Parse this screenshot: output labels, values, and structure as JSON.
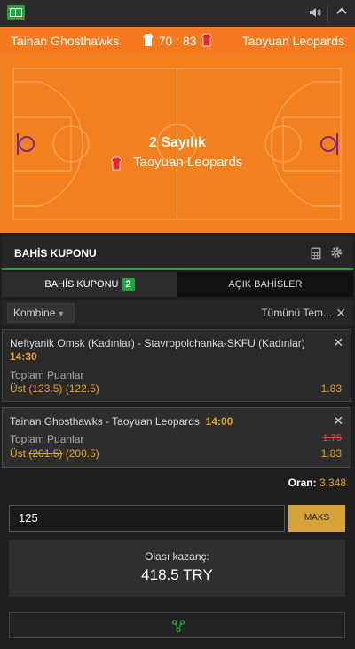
{
  "scoreboard": {
    "home_team": "Tainan Ghosthawks",
    "away_team": "Taoyuan Leopards",
    "score": "70 : 83"
  },
  "event": {
    "title": "2 Sayılık",
    "team": "Taoyuan Leopards"
  },
  "betslip": {
    "header": "BAHİS KUPONU",
    "tabs": [
      {
        "label": "BAHİS KUPONU",
        "badge": "2"
      },
      {
        "label": "AÇIK BAHİSLER"
      }
    ],
    "mode": "Kombine",
    "clear_all": "Tümünü Tem...",
    "bets": [
      {
        "match": "Neftyanik Omsk (Kadınlar) - Stavropolchanka-SKFU (Kadınlar)",
        "time": "14:30",
        "market": "Toplam Puanlar",
        "selection": "Üst",
        "old_line": "(123.5)",
        "new_line": "(122.5)",
        "odd": "1.83"
      },
      {
        "match": "Tainan Ghosthawks - Taoyuan Leopards",
        "time": "14:00",
        "market": "Toplam Puanlar",
        "selection": "Üst",
        "old_line": "(201.5)",
        "new_line": "(200.5)",
        "old_odd": "1.75",
        "odd": "1.83"
      }
    ],
    "total_odds_label": "Oran:",
    "total_odds": "3.348",
    "stake": "125",
    "max_label": "MAKS",
    "potential_win_label": "Olası kazanç:",
    "potential_win": "418.5 TRY"
  },
  "colors": {
    "accent_green": "#1fa83a",
    "court_orange": "#f2801e",
    "odds_gold": "#e2a32a"
  }
}
